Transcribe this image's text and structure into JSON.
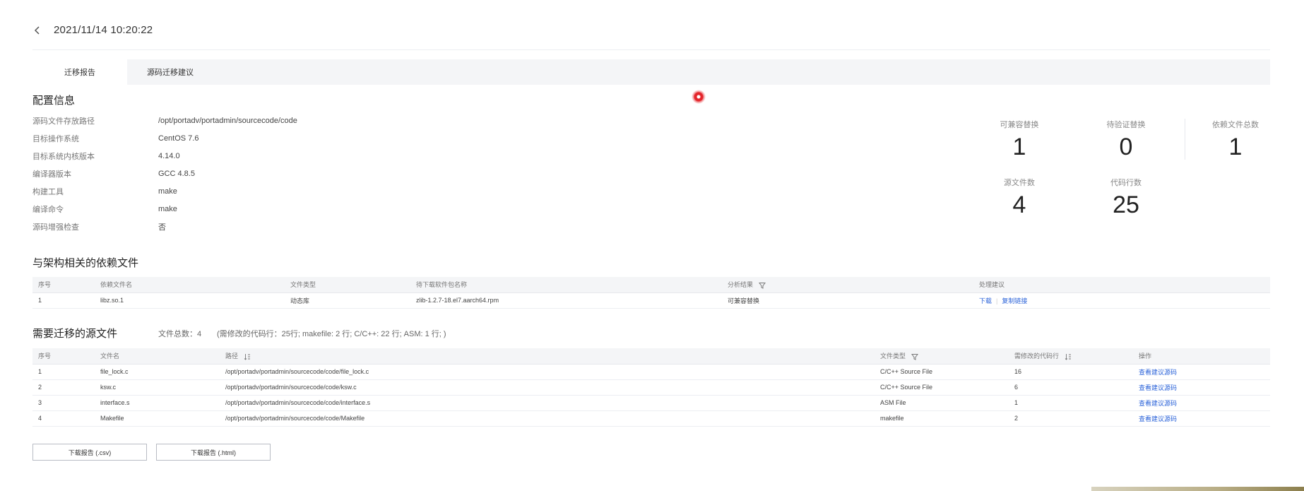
{
  "header": {
    "title": "2021/11/14 10:20:22"
  },
  "tabs": [
    {
      "label": "迁移报告",
      "active": true
    },
    {
      "label": "源码迁移建议",
      "active": false
    }
  ],
  "config": {
    "title": "配置信息",
    "rows": [
      {
        "label": "源码文件存放路径",
        "value": "/opt/portadv/portadmin/sourcecode/code"
      },
      {
        "label": "目标操作系统",
        "value": "CentOS 7.6"
      },
      {
        "label": "目标系统内核版本",
        "value": "4.14.0"
      },
      {
        "label": "编译器版本",
        "value": "GCC 4.8.5"
      },
      {
        "label": "构建工具",
        "value": "make"
      },
      {
        "label": "编译命令",
        "value": "make"
      },
      {
        "label": "源码增强检查",
        "value": "否"
      }
    ]
  },
  "stats": [
    {
      "label": "可兼容替换",
      "value": "1"
    },
    {
      "label": "待验证替换",
      "value": "0"
    },
    {
      "label": "依赖文件总数",
      "value": "1"
    },
    {
      "label": "源文件数",
      "value": "4"
    },
    {
      "label": "代码行数",
      "value": "25"
    }
  ],
  "deps": {
    "title": "与架构相关的依赖文件",
    "columns": [
      "序号",
      "依赖文件名",
      "文件类型",
      "待下载软件包名称",
      "分析结果",
      "处理建议"
    ],
    "rows": [
      {
        "no": "1",
        "name": "libz.so.1",
        "type": "动态库",
        "pkg": "zlib-1.2.7-18.el7.aarch64.rpm",
        "result": "可兼容替换",
        "actions": [
          "下载",
          "复制链接"
        ]
      }
    ]
  },
  "sources": {
    "title": "需要迁移的源文件",
    "total": "文件总数：4",
    "detail": "(需修改的代码行：25行; makefile: 2 行; C/C++: 22 行; ASM: 1 行; )",
    "columns": [
      "序号",
      "文件名",
      "路径",
      "文件类型",
      "需修改的代码行",
      "操作"
    ],
    "rows": [
      {
        "no": "1",
        "name": "file_lock.c",
        "path": "/opt/portadv/portadmin/sourcecode/code/file_lock.c",
        "type": "C/C++ Source File",
        "lines": "16",
        "action": "查看建议源码"
      },
      {
        "no": "2",
        "name": "ksw.c",
        "path": "/opt/portadv/portadmin/sourcecode/code/ksw.c",
        "type": "C/C++ Source File",
        "lines": "6",
        "action": "查看建议源码"
      },
      {
        "no": "3",
        "name": "interface.s",
        "path": "/opt/portadv/portadmin/sourcecode/code/interface.s",
        "type": "ASM File",
        "lines": "1",
        "action": "查看建议源码"
      },
      {
        "no": "4",
        "name": "Makefile",
        "path": "/opt/portadv/portadmin/sourcecode/code/Makefile",
        "type": "makefile",
        "lines": "2",
        "action": "查看建议源码"
      }
    ]
  },
  "buttons": {
    "csv": "下载报告 (.csv)",
    "html": "下载报告 (.html)"
  },
  "icons": {
    "back": "chevron-left-icon",
    "filter": "filter-icon",
    "sort": "sort-icon"
  },
  "colors": {
    "link": "#2b63d9",
    "record_indicator": "#e4252b"
  }
}
